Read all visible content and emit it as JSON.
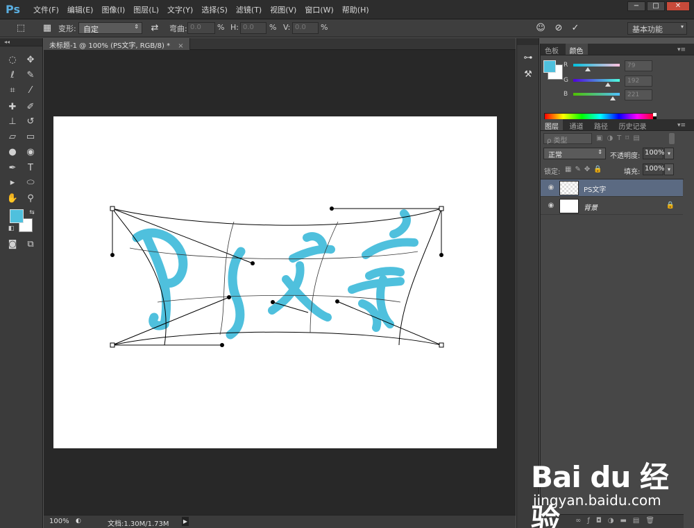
{
  "app": {
    "logo": "Ps"
  },
  "menu": [
    "文件(F)",
    "编辑(E)",
    "图像(I)",
    "图层(L)",
    "文字(Y)",
    "选择(S)",
    "滤镜(T)",
    "视图(V)",
    "窗口(W)",
    "帮助(H)"
  ],
  "window_controls": [
    "−",
    "□",
    "✕"
  ],
  "options": {
    "warp_label": "变形:",
    "warp_value": "自定",
    "bend_label": "弯曲:",
    "bend_value": "0.0",
    "h_label": "H:",
    "h_value": "0.0",
    "v_label": "V:",
    "v_value": "0.0",
    "percent": "%",
    "workspace": "基本功能"
  },
  "document": {
    "tab_title": "未标题-1 @ 100% (PS文字, RGB/8) *",
    "close": "×",
    "zoom": "100%",
    "doc_info": "文档:1.30M/1.73M"
  },
  "color_panel": {
    "tabs": [
      "色板",
      "颜色"
    ],
    "active_tab": "颜色",
    "r_label": "R",
    "r_value": "79",
    "g_label": "G",
    "g_value": "192",
    "b_label": "B",
    "b_value": "221",
    "foreground": "#4fc0dd",
    "background": "#ffffff"
  },
  "layers_panel": {
    "tabs": [
      "图层",
      "通道",
      "路径",
      "历史记录"
    ],
    "active_tab": "图层",
    "filter_label": "ρ 类型",
    "blend_mode": "正常",
    "opacity_label": "不透明度:",
    "opacity_value": "100%",
    "lock_label": "锁定:",
    "fill_label": "填充:",
    "fill_value": "100%",
    "layers": [
      {
        "name": "PS文字",
        "selected": true
      },
      {
        "name": "背景",
        "selected": false
      }
    ]
  },
  "watermark": {
    "brand": "Bai du 经验",
    "url": "jingyan.baidu.com"
  },
  "text_color": "#4fc0dd"
}
